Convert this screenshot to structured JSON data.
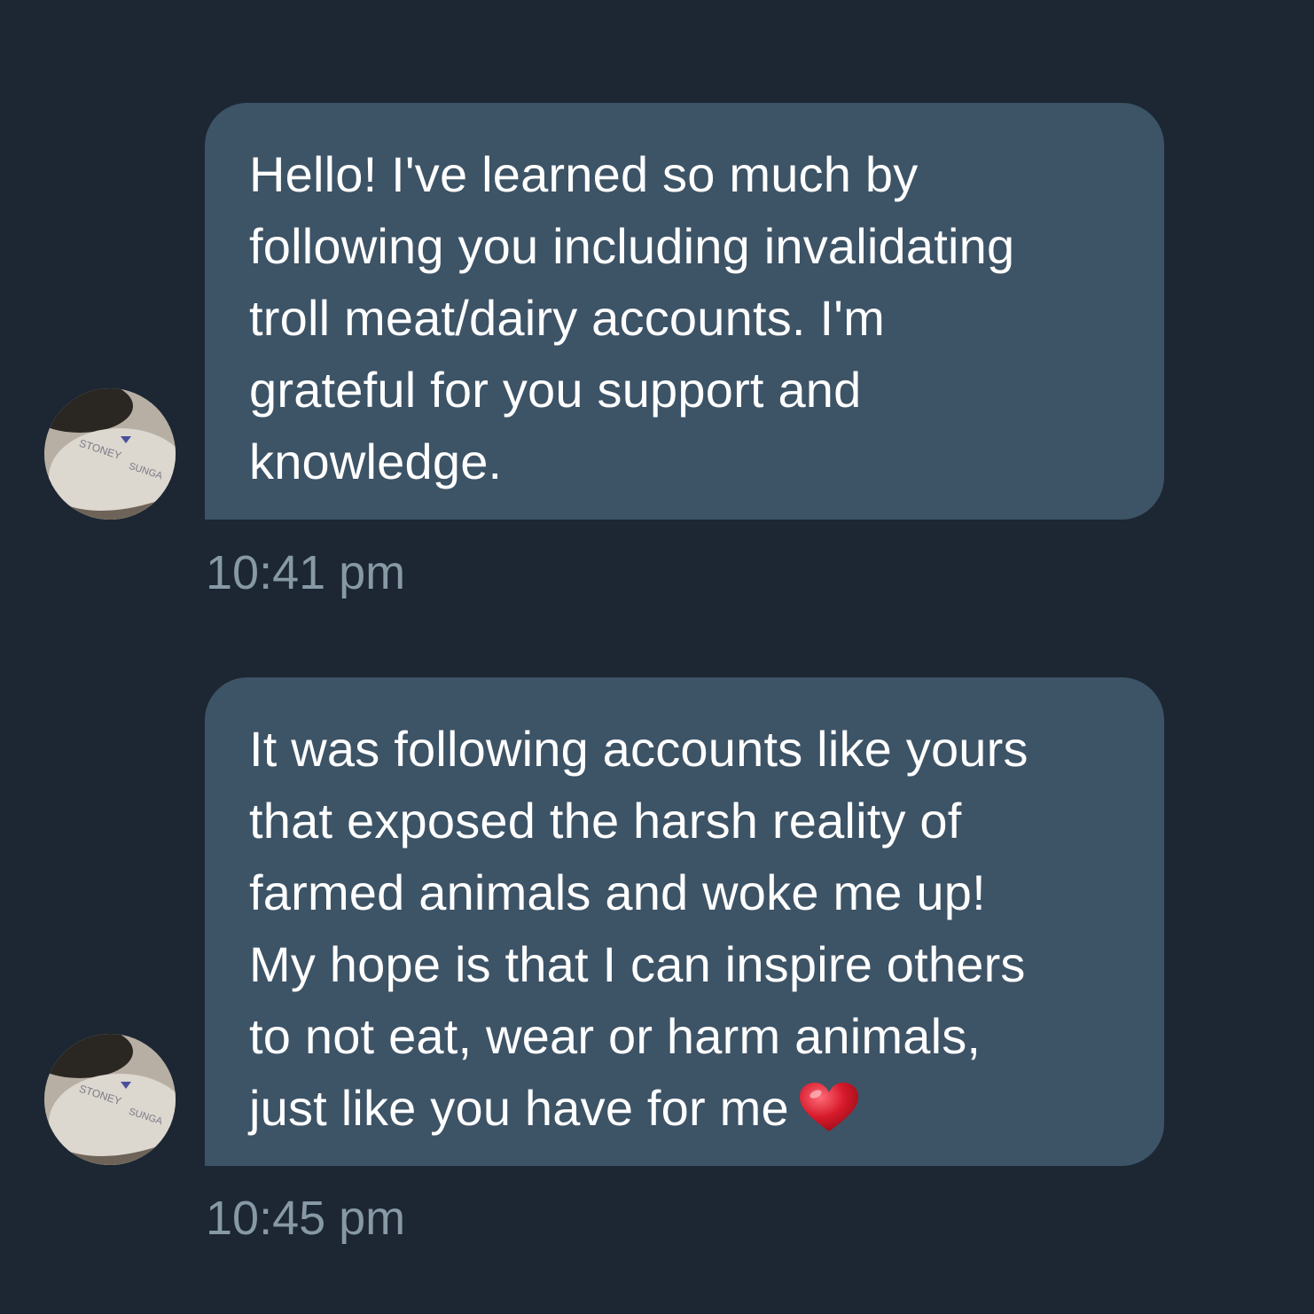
{
  "conversation": {
    "messages": [
      {
        "text": "Hello! I've learned so much by\nfollowing you including invalidating\ntroll meat/dairy accounts. I'm\ngrateful for you support and\nknowledge.",
        "time": "10:41 pm",
        "avatar_icon": "user-avatar"
      },
      {
        "text": "It was following accounts like yours\nthat exposed the harsh reality of\nfarmed animals and woke me up!\nMy hope is that I can inspire others\nto not eat, wear or harm animals,\njust like you have for me",
        "emoji": "heart-icon",
        "time": "10:45 pm",
        "avatar_icon": "user-avatar"
      }
    ]
  },
  "colors": {
    "background": "#1c2733",
    "bubble": "#3d5366",
    "text": "#ffffff",
    "timestamp": "#8899a6",
    "heart": "#d61a2b"
  }
}
